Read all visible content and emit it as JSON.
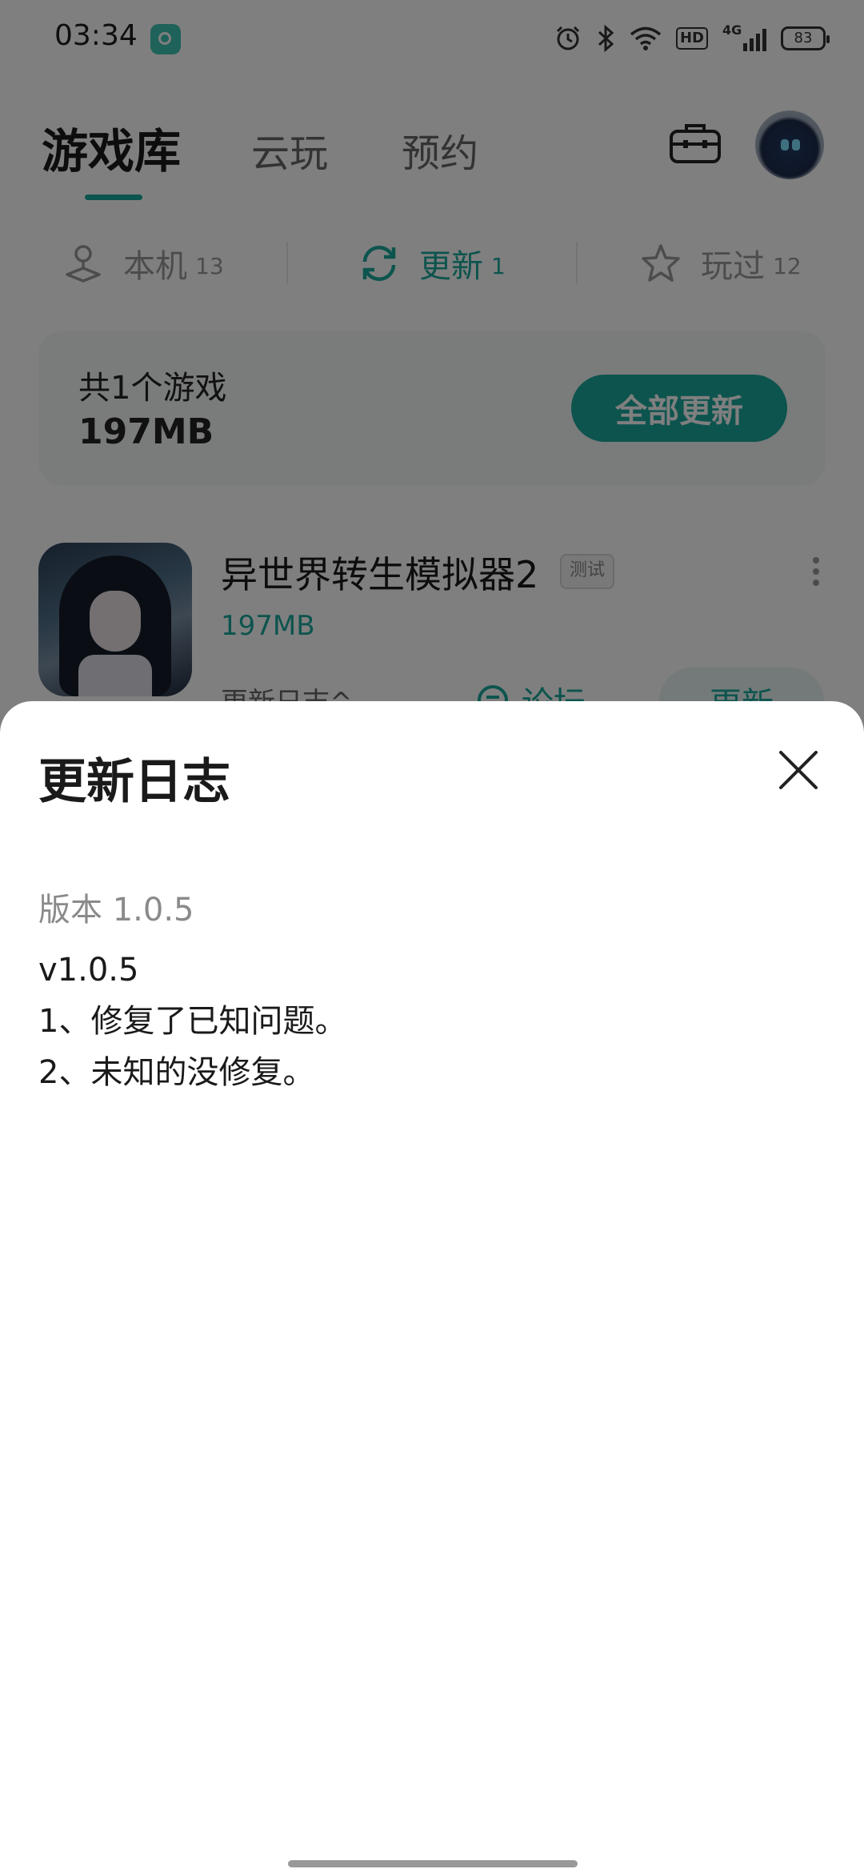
{
  "status_bar": {
    "time": "03:34",
    "network": "4G",
    "hd_label": "HD",
    "battery": "83",
    "icons": [
      "alarm-icon",
      "bluetooth-icon",
      "wifi-icon",
      "hd-icon",
      "signal-icon",
      "battery-icon"
    ]
  },
  "header": {
    "tabs": [
      {
        "label": "游戏库",
        "active": true
      },
      {
        "label": "云玩",
        "active": false
      },
      {
        "label": "预约",
        "active": false
      }
    ],
    "toolbox_icon": "toolbox-icon",
    "avatar_icon": "avatar"
  },
  "segments": [
    {
      "label": "本机",
      "count": "13",
      "icon": "joystick-icon",
      "active": false
    },
    {
      "label": "更新",
      "count": "1",
      "icon": "refresh-icon",
      "active": true
    },
    {
      "label": "玩过",
      "count": "12",
      "icon": "star-icon",
      "active": false
    }
  ],
  "summary": {
    "title": "共1个游戏",
    "size": "197MB",
    "update_all_label": "全部更新"
  },
  "game": {
    "name": "异世界转生模拟器2",
    "badge": "测试",
    "size": "197MB",
    "changelog_link": "更新日志^",
    "forum_label": "论坛",
    "update_label": "更新"
  },
  "sheet": {
    "title": "更新日志",
    "version_label": "版本 1.0.5",
    "body": "v1.0.5\n1、修复了已知问题。\n2、未知的没修复。"
  },
  "colors": {
    "accent": "#1aa99c",
    "overlay": "rgba(0,0,0,0.5)"
  }
}
